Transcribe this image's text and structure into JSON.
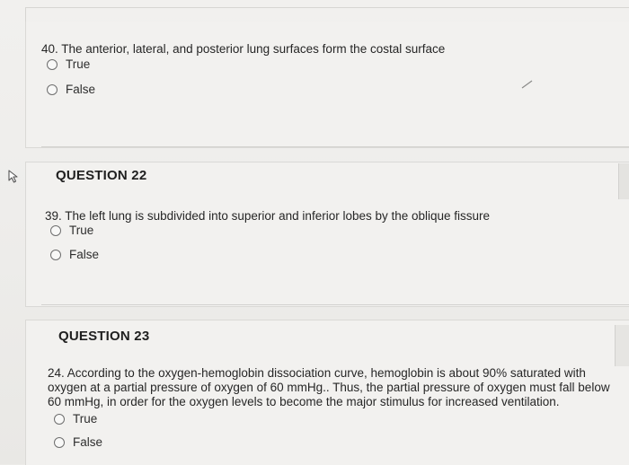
{
  "q40": {
    "text": "40. The anterior, lateral, and posterior lung surfaces form the costal surface",
    "options": [
      "True",
      "False"
    ]
  },
  "q22": {
    "title": "QUESTION 22",
    "text": "39. The left lung is subdivided into superior and inferior lobes by the oblique fissure",
    "options": [
      "True",
      "False"
    ]
  },
  "q23": {
    "title": "QUESTION 23",
    "text_lines": [
      "24. According to the oxygen-hemoglobin dissociation curve, hemoglobin is about 90% saturated with",
      "oxygen at a partial pressure of oxygen of 60 mmHg.. Thus, the partial pressure of oxygen must fall below",
      "60 mmHg, in order for the oxygen levels to become the major stimulus for increased ventilation."
    ],
    "options": [
      "True",
      "False"
    ]
  },
  "icons": {
    "cursor": "mouse-pointer-icon",
    "check": "check-mark-icon"
  },
  "colors": {
    "background": "#ecebe8",
    "panel": "#f2f1ef",
    "border": "#dad9d6",
    "text": "#262626"
  }
}
